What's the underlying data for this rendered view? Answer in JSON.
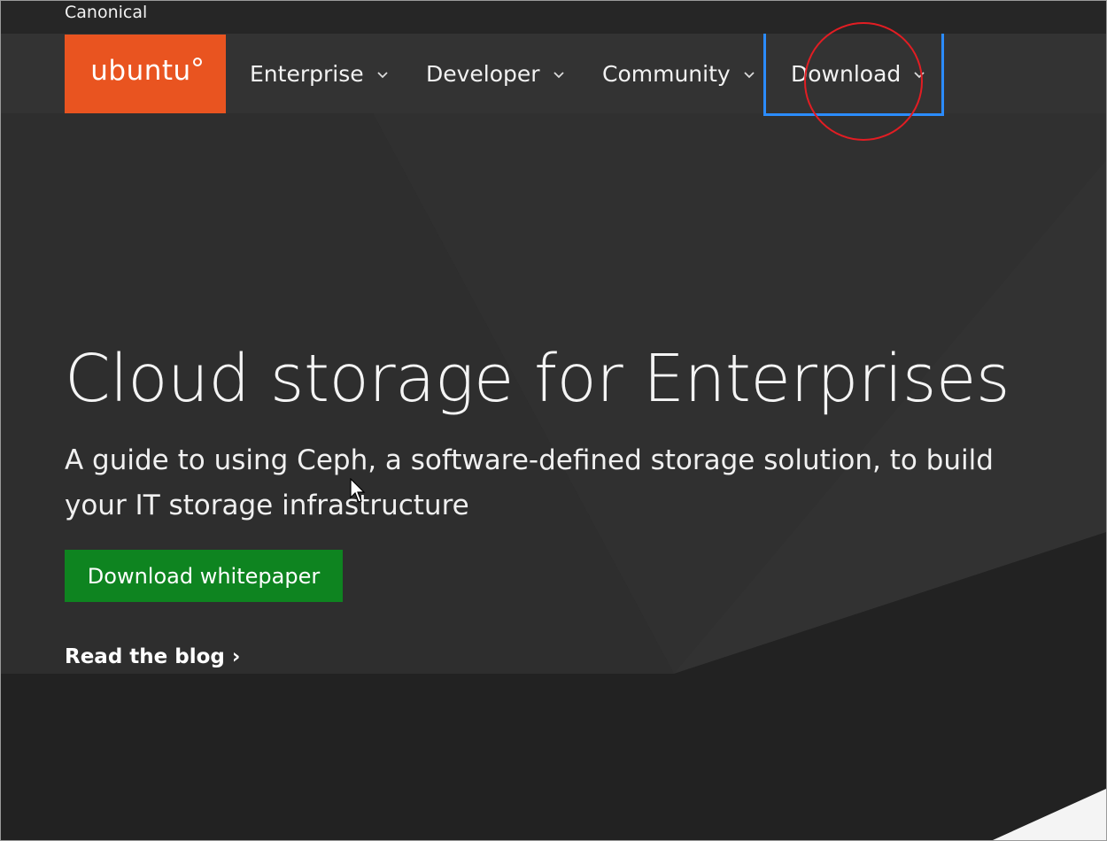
{
  "top_bar": {
    "brand": "Canonical"
  },
  "logo": {
    "text": "ubuntu",
    "bg_color": "#e95420"
  },
  "nav": {
    "items": [
      {
        "label": "Enterprise"
      },
      {
        "label": "Developer"
      },
      {
        "label": "Community"
      },
      {
        "label": "Download"
      }
    ]
  },
  "hero": {
    "title": "Cloud storage for Enterprises",
    "subtitle": "A guide to using Ceph, a software-defined storage solution, to build your IT storage infrastructure",
    "cta_label": "Download whitepaper",
    "cta_color": "#0e8420",
    "blog_link": "Read the blog ›"
  },
  "annotations": {
    "highlight_box_color": "#2b8cff",
    "circle_color": "#e21d23"
  },
  "icons": [
    "chevron-down-icon",
    "cursor-icon",
    "ubuntu-circle-of-friends-icon"
  ]
}
